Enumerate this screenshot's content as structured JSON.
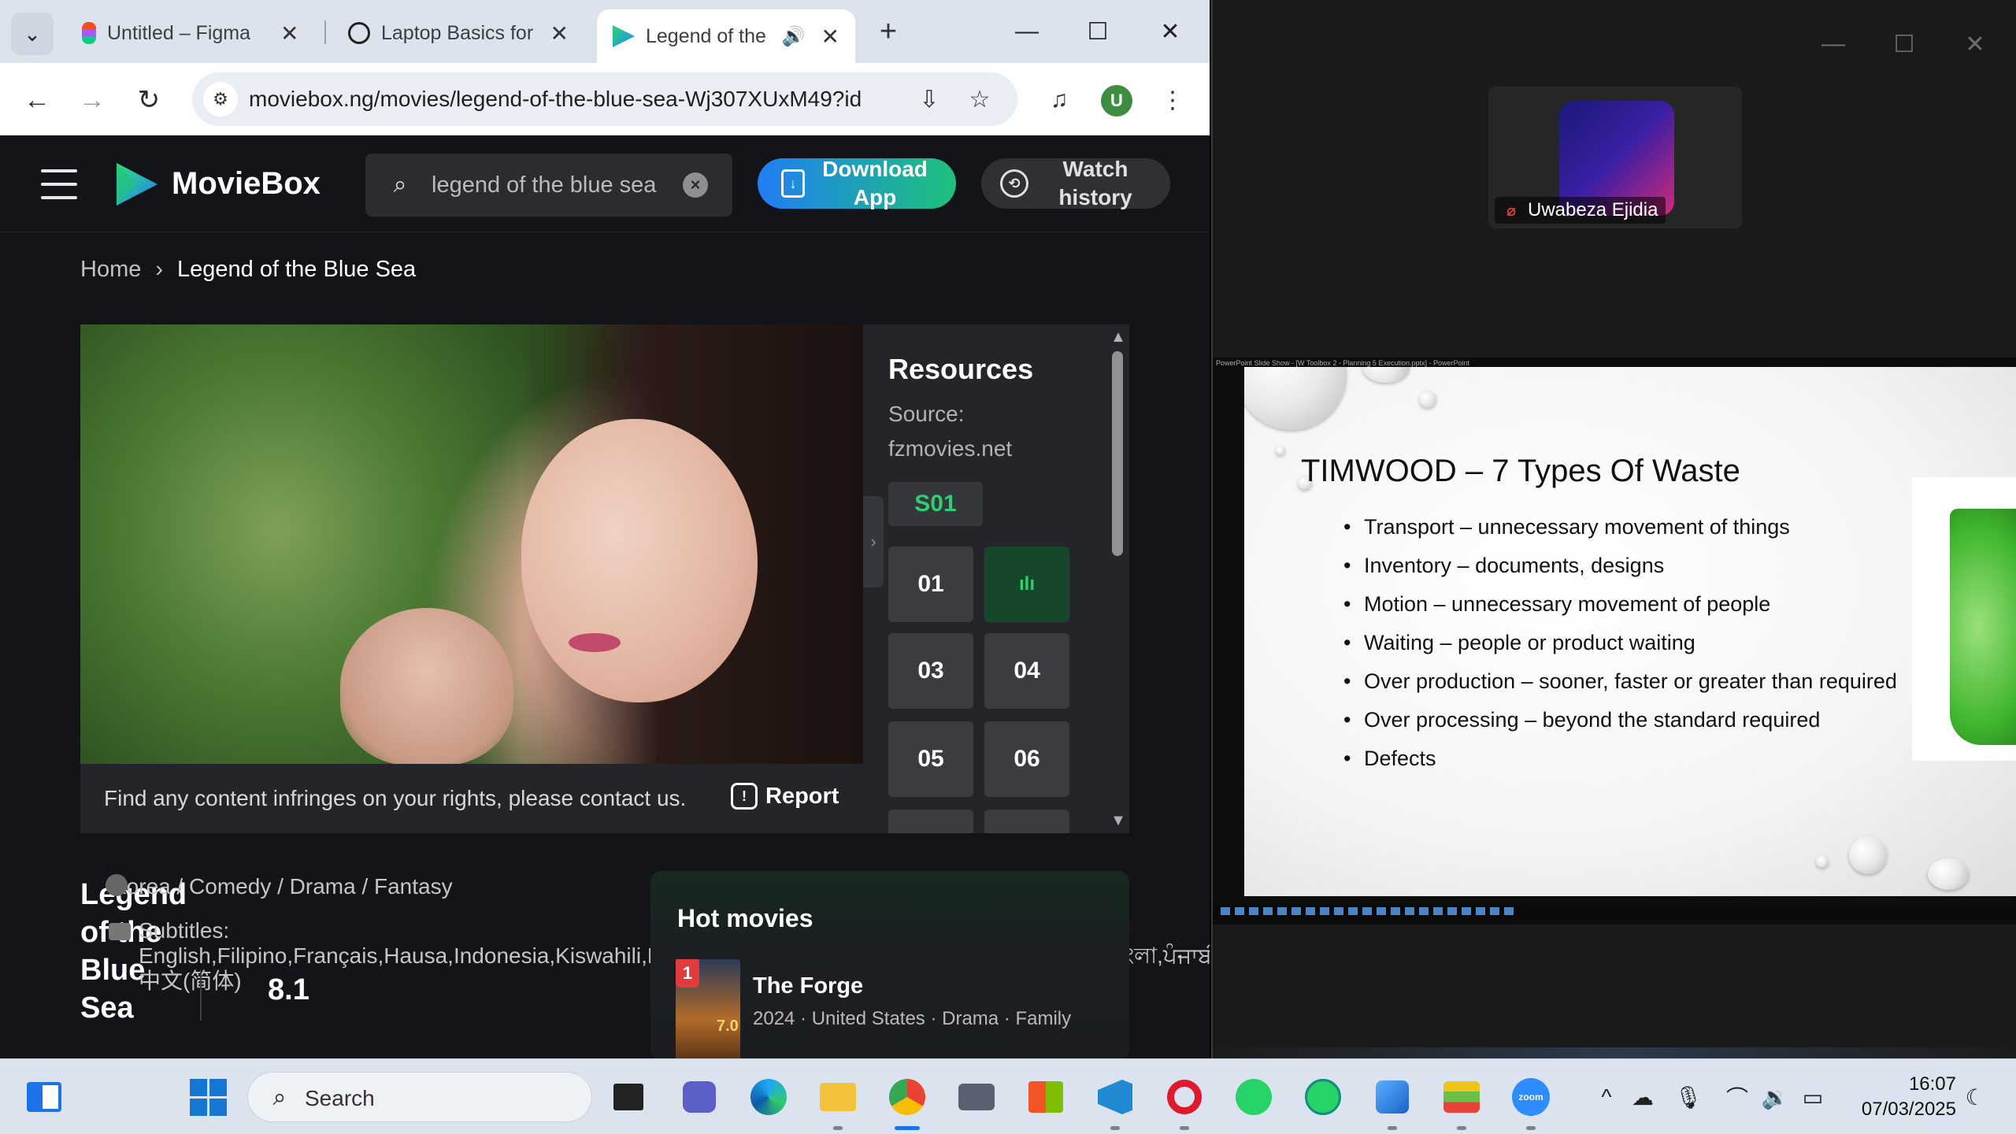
{
  "browser": {
    "tabs": [
      {
        "title": "Untitled – Figma",
        "favicon": "figma-icon"
      },
      {
        "title": "Laptop Basics for Beginners",
        "favicon": "openai-icon"
      },
      {
        "title": "Legend of the Blue Sea",
        "favicon": "moviebox-icon",
        "active": true
      }
    ],
    "url": "moviebox.ng/movies/legend-of-the-blue-sea-Wj307XUxM49?id...",
    "profile_initial": "U"
  },
  "site": {
    "brand": "MovieBox",
    "search": {
      "value": "legend of the blue sea",
      "placeholder": "Search"
    },
    "download_label": "Download App",
    "history_label": "Watch history",
    "breadcrumb": {
      "home": "Home",
      "separator": "›",
      "current": "Legend of the Blue Sea"
    },
    "report_message": "Find any content infringes on your rights, please contact us.",
    "report_label": "Report",
    "resources": {
      "title": "Resources",
      "source": "Source: fzmovies.net",
      "season": "S01",
      "episodes": [
        "01",
        "02",
        "03",
        "04",
        "05",
        "06"
      ],
      "playing_episode": "02"
    },
    "movie": {
      "title": "Legend of the Blue Sea",
      "genres": "Korea / Comedy / Drama / Fantasy",
      "subtitles": "Subtitles: English,Filipino,Français,Hausa,Indonesia,Kiswahili,Português,es,fa,ms,th,tr,vi,Русский,العربية,اردو,বাংলা,ਪੰਜਾਬੀ,中文(简体)",
      "rating": "8.1"
    },
    "hot_movies": {
      "heading": "Hot movies",
      "items": [
        {
          "rank": "1",
          "title": "The Forge",
          "meta": "2024 · United States · Drama · Family",
          "score": "7.0"
        }
      ]
    }
  },
  "zoom": {
    "participant_name": "Uwabeza Ejidia",
    "share_caption": "PowerPoint Slide Show - [W Toolbox 2 - Planning 5 Execution.pptx] - PowerPoint",
    "slide": {
      "title": "TIMWOOD – 7 Types Of Waste",
      "bullets": [
        "Transport – unnecessary movement of things",
        "Inventory – documents, designs",
        "Motion – unnecessary movement of people",
        "Waiting – people or product waiting",
        "Over production – sooner, faster or greater than required",
        "Over processing – beyond the standard required",
        "Defects"
      ]
    }
  },
  "taskbar": {
    "search_label": "Search",
    "time": "16:07",
    "date": "07/03/2025",
    "apps": [
      "widgets-icon",
      "start-icon",
      "task-view-icon",
      "teams-chat-icon",
      "edge-icon",
      "file-explorer-icon",
      "chrome-icon",
      "camera-icon",
      "microsoft-store-icon",
      "vscode-icon",
      "opera-icon",
      "whatsapp-icon",
      "whatsapp-business-icon",
      "photos-icon",
      "bluestacks-icon",
      "zoom-icon"
    ]
  }
}
